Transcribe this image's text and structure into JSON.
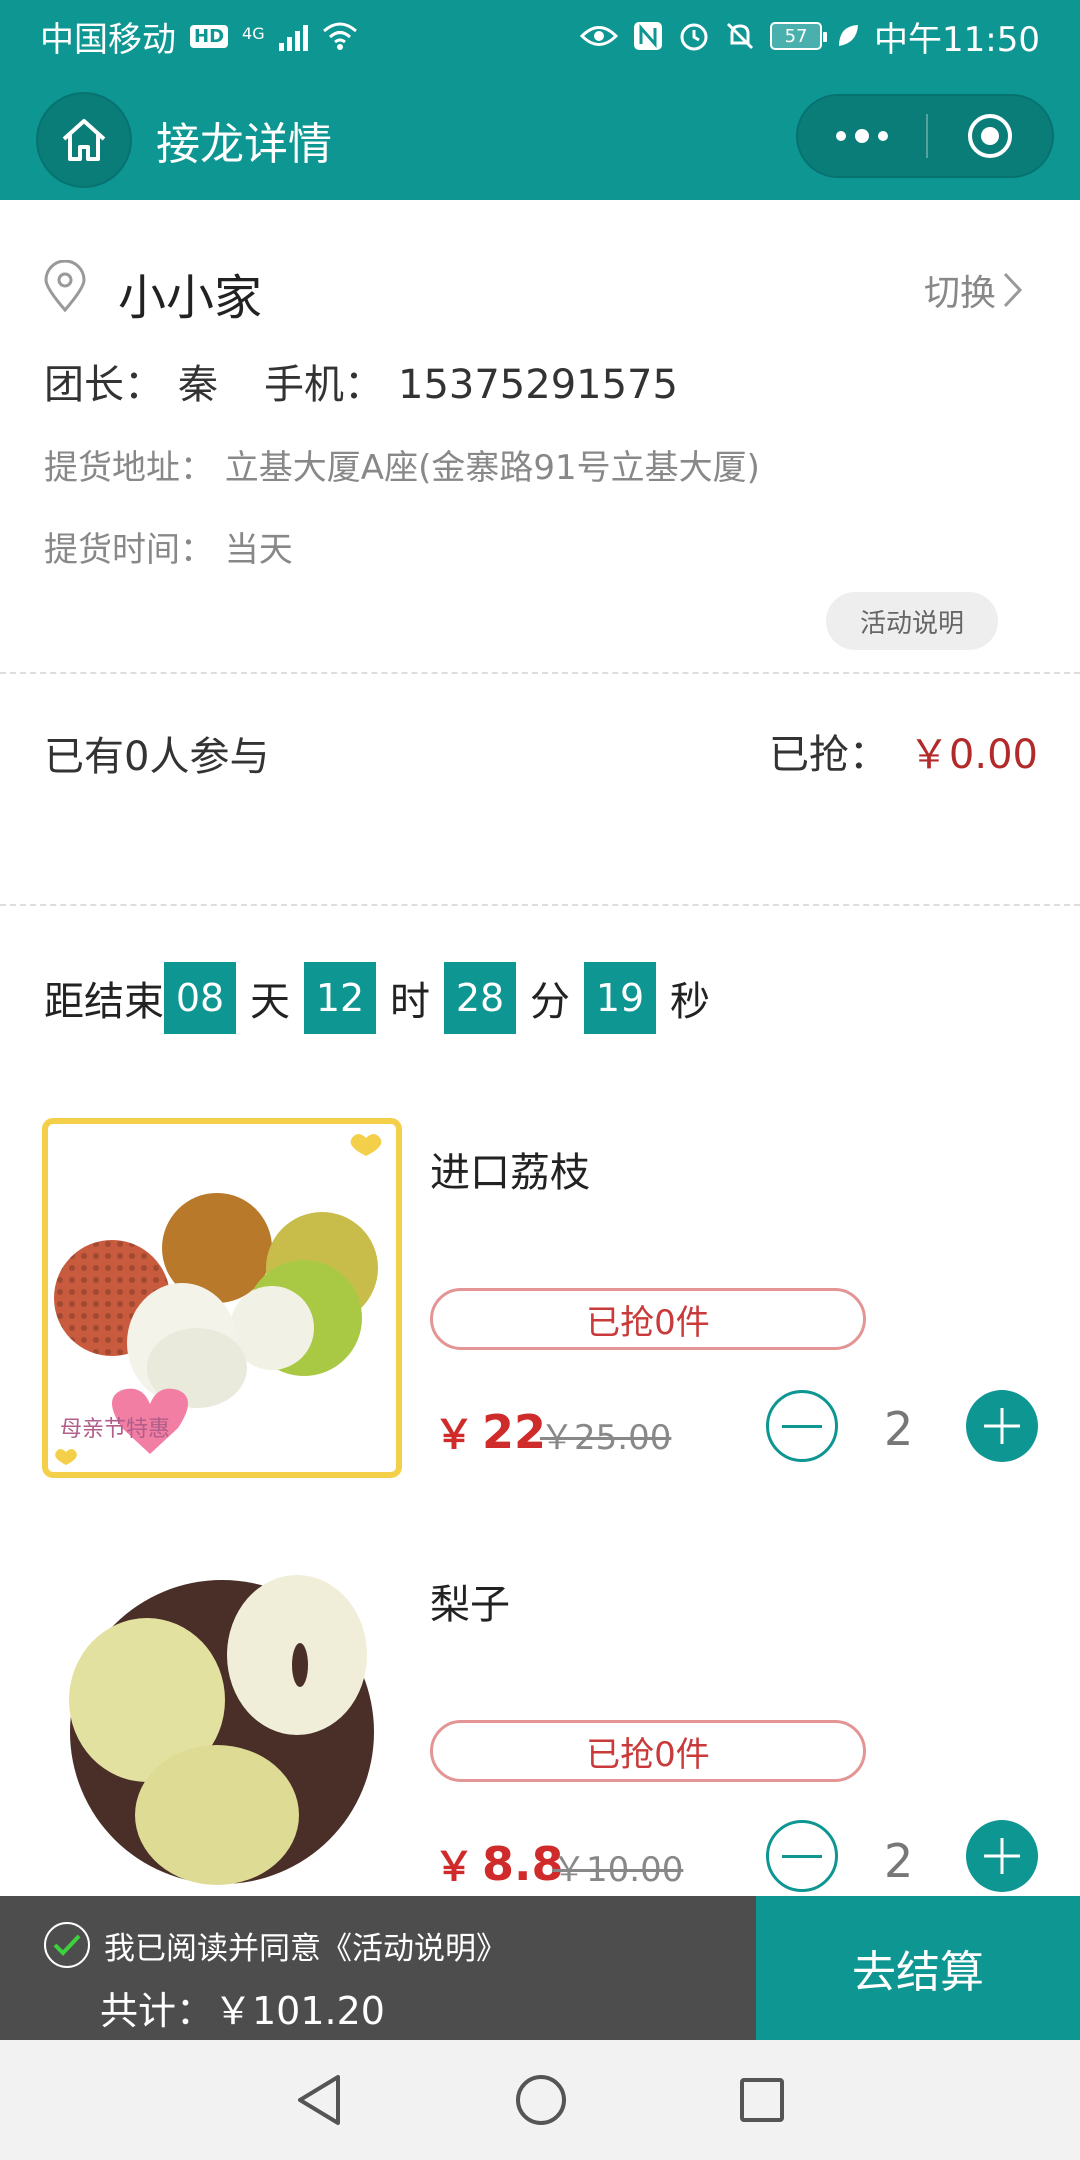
{
  "status_bar": {
    "carrier": "中国移动",
    "hd": "HD",
    "network": "4G",
    "battery": "57",
    "time": "中午11:50"
  },
  "nav": {
    "title": "接龙详情"
  },
  "store": {
    "name": "小小家",
    "switch_label": "切换",
    "leader_label": "团长：",
    "leader_name": "秦",
    "phone_label": "手机：",
    "phone": "15375291575",
    "address": "提货地址：  立基大厦A座(金寨路91号立基大厦)",
    "pickup_time": "提货时间：  当天",
    "activity_button": "活动说明"
  },
  "stats": {
    "participants": "已有0人参与",
    "grabbed_label": "已抢：",
    "grabbed_amount": "￥0.00"
  },
  "countdown": {
    "prefix": "距结束",
    "days": "08",
    "days_unit": "天",
    "hours": "12",
    "hours_unit": "时",
    "minutes": "28",
    "minutes_unit": "分",
    "seconds": "19",
    "seconds_unit": "秒"
  },
  "products": [
    {
      "name": "进口荔枝",
      "grabbed": "已抢0件",
      "currency": "￥",
      "price": "22",
      "original_price": "￥25.00",
      "quantity": "2",
      "image_caption": "母亲节特惠"
    },
    {
      "name": "梨子",
      "grabbed": "已抢0件",
      "currency": "￥",
      "price": "8.8",
      "original_price": "￥10.00",
      "quantity": "2"
    }
  ],
  "footer": {
    "agree_text": "我已阅读并同意《活动说明》",
    "total": "共计：￥101.20",
    "checkout": "去结算"
  },
  "colors": {
    "primary": "#0e9692",
    "price": "#d02b2b",
    "footer_bg": "#4d4d4d"
  }
}
